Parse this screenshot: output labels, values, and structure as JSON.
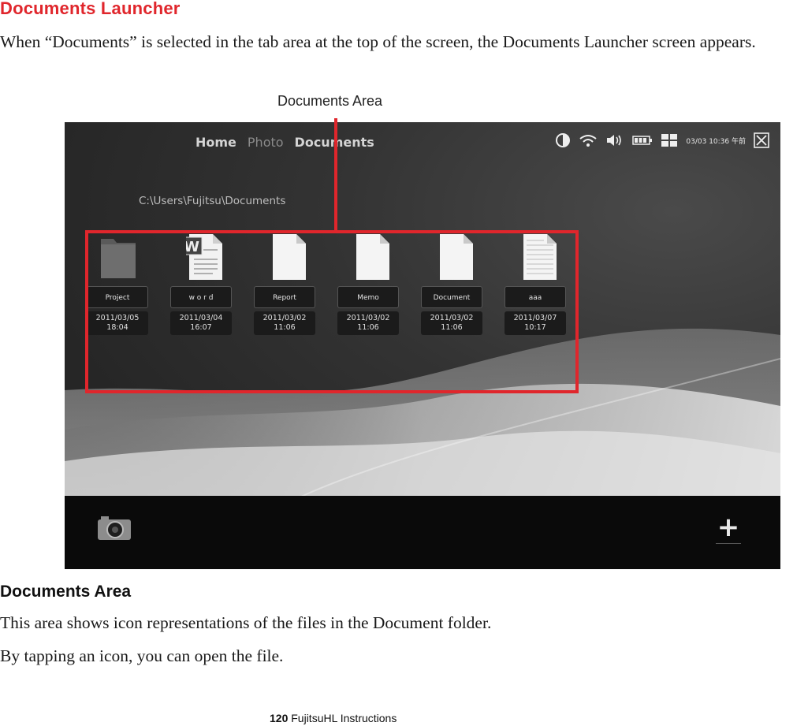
{
  "section_title": "Documents Launcher",
  "intro_text": "When “Documents” is selected in the tab area at the top of the screen, the Documents Launcher screen appears.",
  "callout_label": "Documents Area",
  "screen": {
    "tabs": [
      {
        "label": "Home",
        "active": false
      },
      {
        "label": "Photo",
        "active": false
      },
      {
        "label": "Documents",
        "active": true
      }
    ],
    "status_time": "03/03 10:36 午前",
    "status_icons": [
      "contrast-icon",
      "wifi-icon",
      "volume-icon",
      "battery-icon",
      "grid-icon",
      "close-icon"
    ],
    "path": "C:\\Users\\Fujitsu\\Documents",
    "items": [
      {
        "name": "Project",
        "date": "2011/03/05",
        "time": "18:04",
        "icon": "folder-icon"
      },
      {
        "name": "w o r d",
        "date": "2011/03/04",
        "time": "16:07",
        "icon": "word-document-icon"
      },
      {
        "name": "Report",
        "date": "2011/03/02",
        "time": "11:06",
        "icon": "blank-document-icon"
      },
      {
        "name": "Memo",
        "date": "2011/03/02",
        "time": "11:06",
        "icon": "blank-document-icon"
      },
      {
        "name": "Document",
        "date": "2011/03/02",
        "time": "11:06",
        "icon": "blank-document-icon"
      },
      {
        "name": "aaa",
        "date": "2011/03/07",
        "time": "10:17",
        "icon": "text-document-icon"
      }
    ],
    "bottom_add_label": "+"
  },
  "area_heading": "Documents Area",
  "area_description": "This area shows icon representations of the files in the Document folder.",
  "area_tap_text": "By tapping an icon, you can open the file.",
  "footer": {
    "page_number": "120",
    "text": "FujitsuHL Instructions"
  },
  "colors": {
    "accent_red": "#e0262c"
  }
}
